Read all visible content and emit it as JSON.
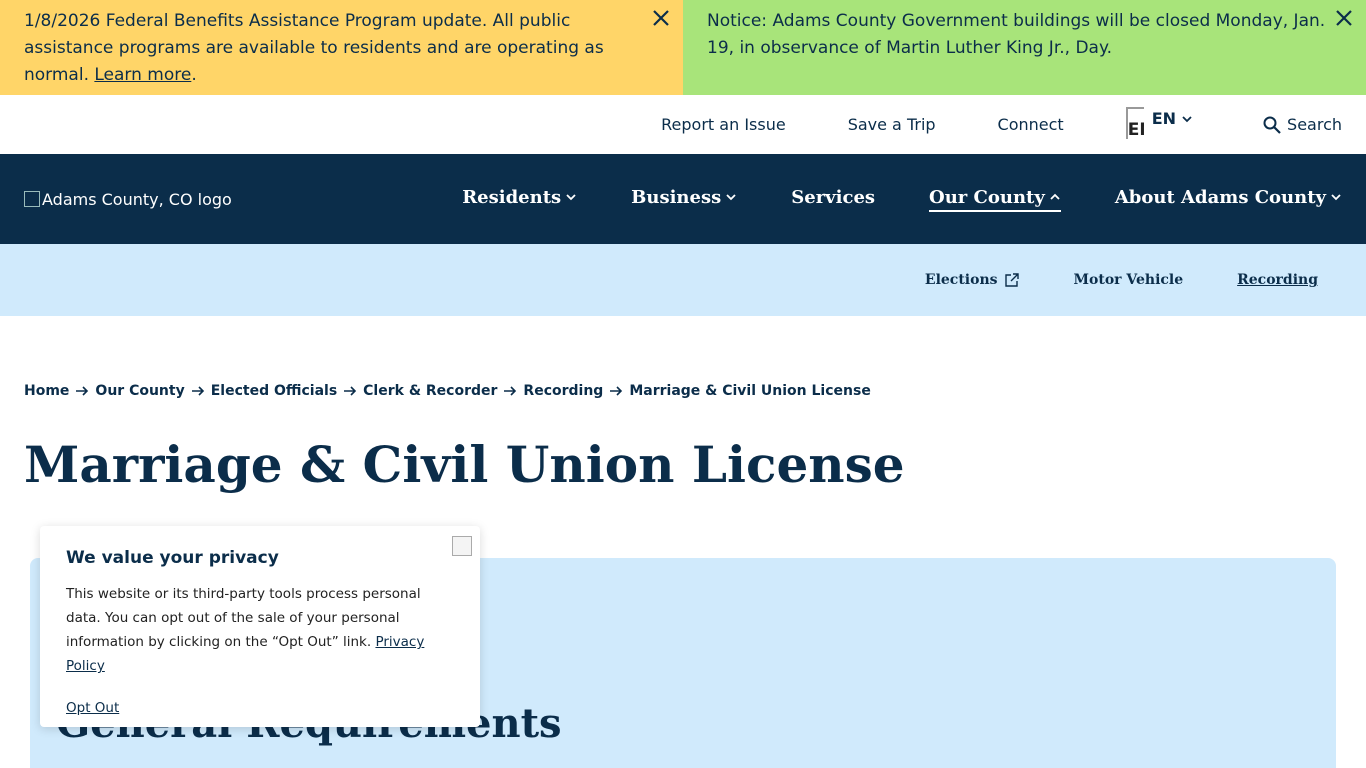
{
  "alerts": [
    {
      "text": "1/8/2026 Federal Benefits Assistance Program update. All public assistance programs are available to residents and are operating as normal. ",
      "link": "Learn more",
      "after": "."
    },
    {
      "text": "Notice: Adams County Government buildings will be closed Monday, Jan. 19, in observance of Martin Luther King Jr., Day."
    }
  ],
  "utility": {
    "links": [
      "Report an Issue",
      "Save a Trip",
      "Connect"
    ],
    "lang_flag": "EN",
    "lang_code": "EN",
    "search": "Search"
  },
  "logo": {
    "alt": "Adams County, CO logo"
  },
  "nav": {
    "items": [
      {
        "label": "Residents"
      },
      {
        "label": "Business"
      },
      {
        "label": "Services"
      },
      {
        "label": "Our County"
      },
      {
        "label": "About Adams County"
      }
    ]
  },
  "subnav": {
    "items": [
      {
        "label": "Elections"
      },
      {
        "label": "Motor Vehicle"
      },
      {
        "label": "Recording"
      }
    ]
  },
  "breadcrumb": [
    "Home",
    "Our County",
    "Elected Officials",
    "Clerk & Recorder",
    "Recording",
    "Marriage & Civil Union License"
  ],
  "page": {
    "title": "Marriage & Civil Union License",
    "section_title": "General Requirements"
  },
  "privacy": {
    "title": "We value your privacy",
    "body": "This website or its third-party tools process personal data. You can opt out of the sale of your personal information by clicking on the “Opt Out” link.",
    "policy_link": "Privacy Policy",
    "opt_out": "Opt Out"
  },
  "colors": {
    "navy": "#0b2d4a",
    "alert_yellow": "#ffd568",
    "alert_green": "#a8e47a",
    "light_blue": "#d0eafc"
  }
}
